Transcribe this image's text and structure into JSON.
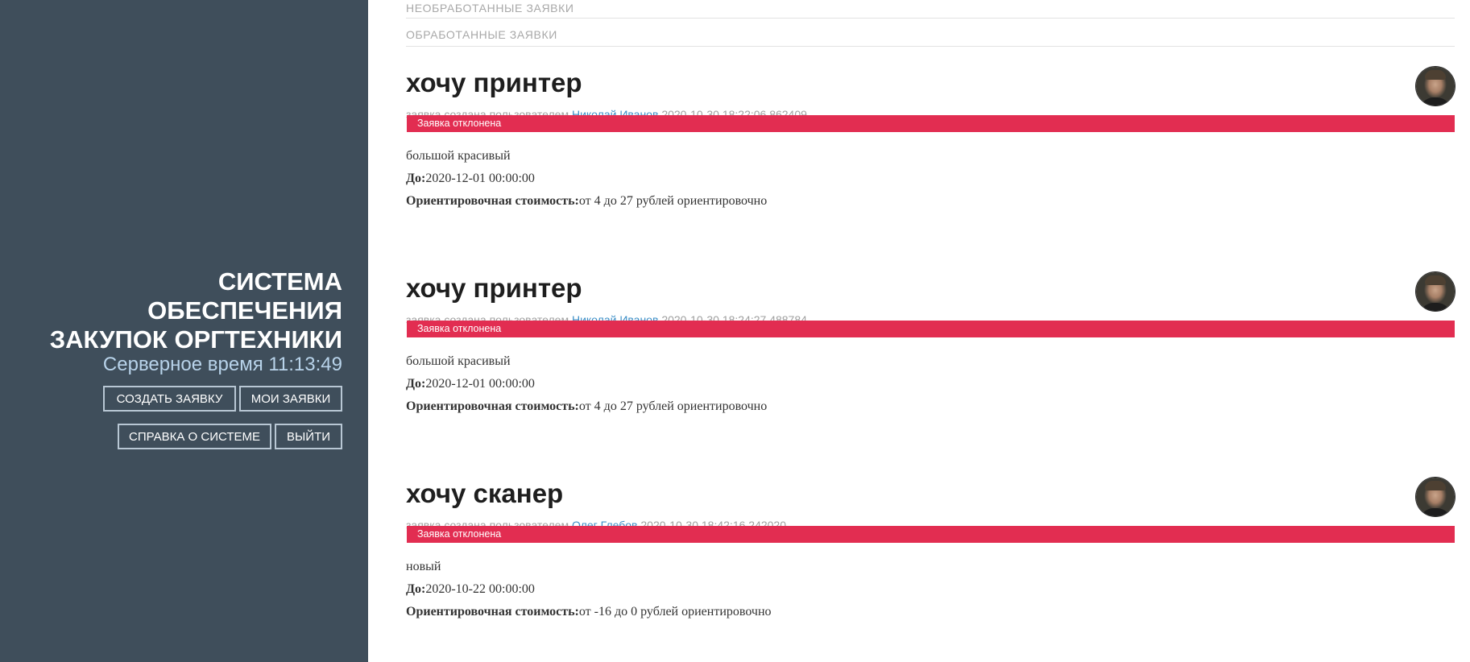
{
  "sidebar": {
    "brand_lines": [
      "СИСТЕМА",
      "ОБЕСПЕЧЕНИЯ",
      "ЗАКУПОК ОРГТЕХНИКИ"
    ],
    "server_time_label": "Серверное время 11:13:49",
    "buttons": {
      "create": "СОЗДАТЬ ЗАЯВКУ",
      "my": "МОИ ЗАЯВКИ",
      "help": "СПРАВКА О СИСТЕМЕ",
      "logout": "ВЫЙТИ"
    }
  },
  "tabs": {
    "unprocessed": "НЕОБРАБОТАННЫЕ ЗАЯВКИ",
    "processed": "ОБРАБОТАННЫЕ ЗАЯВКИ"
  },
  "requests": [
    {
      "title": "хочу принтер",
      "meta_prefix": "заявка создана пользователем",
      "user": "Николай Иванов",
      "created": "2020-10-30 18:22:06.862409",
      "status": "Заявка отклонена",
      "description": "большой красивый",
      "until_label": "До:",
      "until_value": "2020-12-01 00:00:00",
      "cost_label": "Ориентировочная стоимость:",
      "cost_value": "от 4 до 27 рублей ориентировочно"
    },
    {
      "title": "хочу принтер",
      "meta_prefix": "заявка создана пользователем",
      "user": "Николай Иванов",
      "created": "2020-10-30 18:24:27.488784",
      "status": "Заявка отклонена",
      "description": "большой красивый",
      "until_label": "До:",
      "until_value": "2020-12-01 00:00:00",
      "cost_label": "Ориентировочная стоимость:",
      "cost_value": "от 4 до 27 рублей ориентировочно"
    },
    {
      "title": "хочу сканер",
      "meta_prefix": "заявка создана пользователем",
      "user": "Олег Глебов",
      "created": "2020-10-30 18:42:16.242020",
      "status": "Заявка отклонена",
      "description": "новый",
      "until_label": "До:",
      "until_value": "2020-10-22 00:00:00",
      "cost_label": "Ориентировочная стоимость:",
      "cost_value": "от -16 до 0 рублей ориентировочно"
    }
  ],
  "colors": {
    "sidebar_bg": "#3f4e5b",
    "status_rejected": "#e22d51",
    "user_link": "#3d8fc7",
    "server_time": "#b8d3ea"
  }
}
